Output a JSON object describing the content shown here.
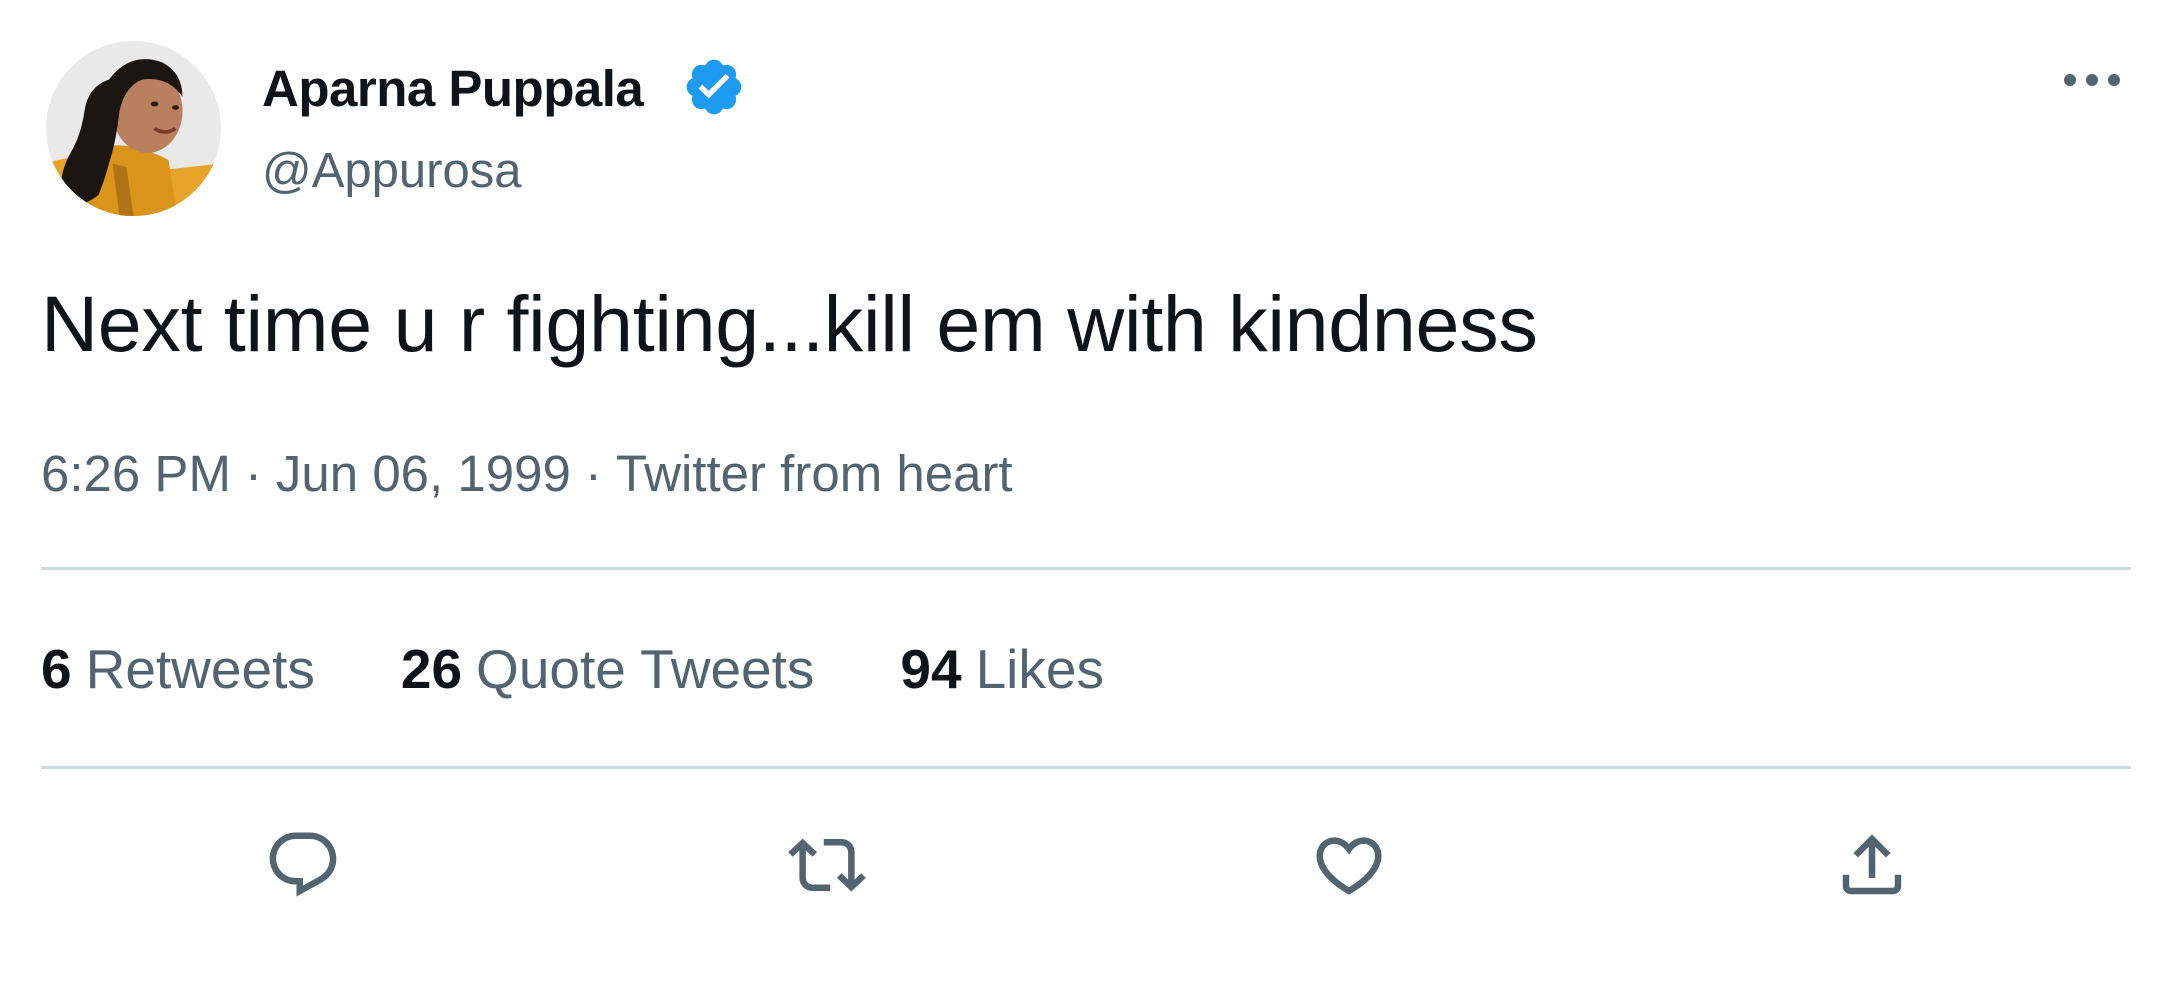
{
  "author": {
    "display_name": "Aparna Puppala",
    "handle": "@Appurosa",
    "verified": true,
    "avatar_icon": "profile-photo"
  },
  "tweet": {
    "text": "Next time u r fighting...kill em with kindness",
    "time": "6:26 PM",
    "date": "Jun 06, 1999",
    "source": "Twitter from heart",
    "separator": "·"
  },
  "stats": {
    "retweets": {
      "count": "6",
      "label": "Retweets"
    },
    "quote_tweets": {
      "count": "26",
      "label": "Quote Tweets"
    },
    "likes": {
      "count": "94",
      "label": "Likes"
    }
  },
  "icons": {
    "more": "more-horizontal-icon",
    "verified": "verified-badge-icon",
    "reply": "reply-icon",
    "retweet": "retweet-icon",
    "like": "heart-icon",
    "share": "share-icon"
  },
  "colors": {
    "text_primary": "#0f1419",
    "text_secondary": "#536471",
    "verified_blue": "#1d9bf0",
    "divider": "#cfd9de",
    "background": "#ffffff"
  }
}
